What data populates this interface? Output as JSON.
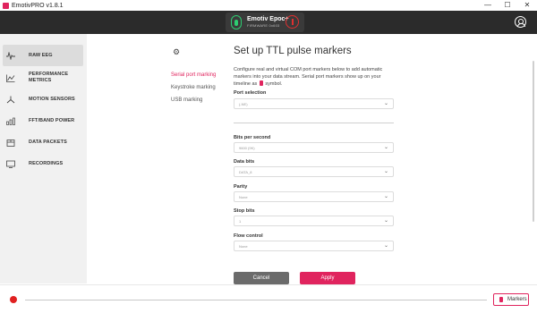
{
  "window": {
    "title": "EmotivPRO v1.8.1",
    "controls": [
      "—",
      "☐",
      "✕"
    ]
  },
  "device": {
    "name": "Emotiv Epoc+",
    "firmware": "FIRMWARE 0x603"
  },
  "sidebar": {
    "items": [
      {
        "label": "RAW EEG",
        "icon": "wave-icon",
        "active": true
      },
      {
        "label": "PERFORMANCE METRICS",
        "icon": "chart-line-icon",
        "active": false
      },
      {
        "label": "MOTION SENSORS",
        "icon": "motion-icon",
        "active": false
      },
      {
        "label": "FFT/BAND POWER",
        "icon": "bar-chart-icon",
        "active": false
      },
      {
        "label": "DATA PACKETS",
        "icon": "package-icon",
        "active": false
      },
      {
        "label": "RECORDINGS",
        "icon": "recording-icon",
        "active": false
      }
    ]
  },
  "subnav": {
    "items": [
      {
        "label": "Serial port marking",
        "active": true
      },
      {
        "label": "Keystroke marking",
        "active": false
      },
      {
        "label": "USB marking",
        "active": false
      }
    ]
  },
  "main": {
    "title": "Set up TTL pulse markers",
    "description_before": "Configure real and virtual COM port markers below to add automatic markers into your data stream. Serial port markers show up on your timeline as",
    "description_after": "symbol.",
    "fields": {
      "port": {
        "label": "Port selection",
        "value": "(-NE)"
      },
      "baud": {
        "label": "Bits per second",
        "value": "9600 (9K)"
      },
      "data_bits": {
        "label": "Data bits",
        "value": "DATA_8"
      },
      "parity": {
        "label": "Parity",
        "value": "None"
      },
      "stop_bits": {
        "label": "Stop bits",
        "value": "1"
      },
      "flow": {
        "label": "Flow control",
        "value": "None"
      }
    },
    "cancel_label": "Cancel",
    "apply_label": "Apply"
  },
  "bottom": {
    "markers_label": "Markers"
  },
  "colors": {
    "accent": "#e0245e",
    "header": "#2b2b2b",
    "sidebar": "#f1f1f1",
    "status_ok": "#2ecc71",
    "status_err": "#e03030"
  }
}
